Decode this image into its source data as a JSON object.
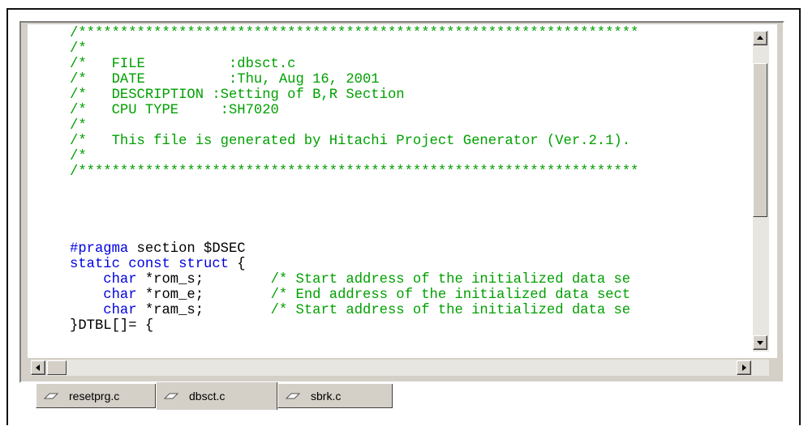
{
  "editor": {
    "lines": [
      {
        "cls": "c",
        "text": "/*******************************************************************"
      },
      {
        "cls": "c",
        "text": "/*"
      },
      {
        "cls": "c",
        "text": "/*   FILE          :dbsct.c"
      },
      {
        "cls": "c",
        "text": "/*   DATE          :Thu, Aug 16, 2001"
      },
      {
        "cls": "c",
        "text": "/*   DESCRIPTION :Setting of B,R Section"
      },
      {
        "cls": "c",
        "text": "/*   CPU TYPE     :SH7020"
      },
      {
        "cls": "c",
        "text": "/*"
      },
      {
        "cls": "c",
        "text": "/*   This file is generated by Hitachi Project Generator (Ver.2.1)."
      },
      {
        "cls": "c",
        "text": "/*"
      },
      {
        "cls": "c",
        "text": "/*******************************************************************"
      },
      {
        "cls": "",
        "text": ""
      },
      {
        "cls": "",
        "text": ""
      },
      {
        "cls": "",
        "text": ""
      },
      {
        "cls": "",
        "text": ""
      },
      {
        "parts": [
          {
            "cls": "k",
            "text": "#pragma"
          },
          {
            "cls": "",
            "text": " section $DSEC"
          }
        ]
      },
      {
        "parts": [
          {
            "cls": "k",
            "text": "static const struct"
          },
          {
            "cls": "",
            "text": " {"
          }
        ]
      },
      {
        "parts": [
          {
            "cls": "",
            "text": "    "
          },
          {
            "cls": "k",
            "text": "char"
          },
          {
            "cls": "",
            "text": " *rom_s;        "
          },
          {
            "cls": "c",
            "text": "/* Start address of the initialized data se"
          }
        ]
      },
      {
        "parts": [
          {
            "cls": "",
            "text": "    "
          },
          {
            "cls": "k",
            "text": "char"
          },
          {
            "cls": "",
            "text": " *rom_e;        "
          },
          {
            "cls": "c",
            "text": "/* End address of the initialized data sect"
          }
        ]
      },
      {
        "parts": [
          {
            "cls": "",
            "text": "    "
          },
          {
            "cls": "k",
            "text": "char"
          },
          {
            "cls": "",
            "text": " *ram_s;        "
          },
          {
            "cls": "c",
            "text": "/* Start address of the initialized data se"
          }
        ]
      },
      {
        "cls": "",
        "text": "}DTBL[]= {"
      }
    ]
  },
  "tabs": [
    {
      "label": "resetprg.c",
      "active": false
    },
    {
      "label": "dbsct.c",
      "active": true
    },
    {
      "label": "sbrk.c",
      "active": false
    }
  ],
  "colors": {
    "comment": "#00a000",
    "keyword": "#0000e0",
    "chrome": "#d4d0c8"
  }
}
